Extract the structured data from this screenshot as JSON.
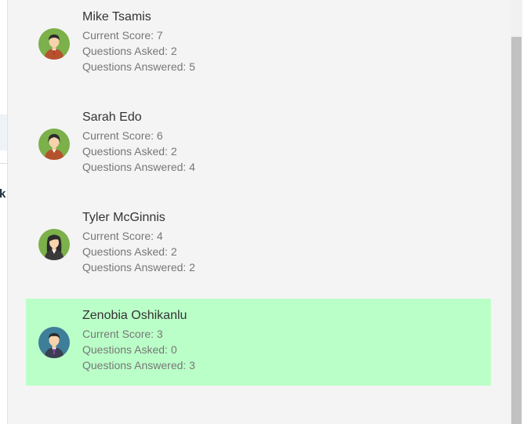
{
  "players": [
    {
      "name": "Mike Tsamis",
      "score": "Current Score: 7",
      "asked": "Questions Asked: 2",
      "answered": "Questions Answered: 5",
      "avatar": "male-avatar-icon",
      "highlighted": false
    },
    {
      "name": "Sarah Edo",
      "score": "Current Score: 6",
      "asked": "Questions Asked: 2",
      "answered": "Questions Answered: 4",
      "avatar": "female-avatar-icon",
      "highlighted": false
    },
    {
      "name": "Tyler McGinnis",
      "score": "Current Score: 4",
      "asked": "Questions Asked: 2",
      "answered": "Questions Answered: 2",
      "avatar": "female-avatar-icon",
      "highlighted": false
    },
    {
      "name": "Zenobia Oshikanlu",
      "score": "Current Score: 3",
      "asked": "Questions Asked: 0",
      "answered": "Questions Answered: 3",
      "avatar": "male-avatar-icon",
      "highlighted": true
    }
  ],
  "background_page": {
    "partial_text": "k"
  },
  "colors": {
    "highlight": "#bbffc8",
    "avatar_green": "#7bb04a",
    "avatar_teal": "#3f7e99"
  }
}
